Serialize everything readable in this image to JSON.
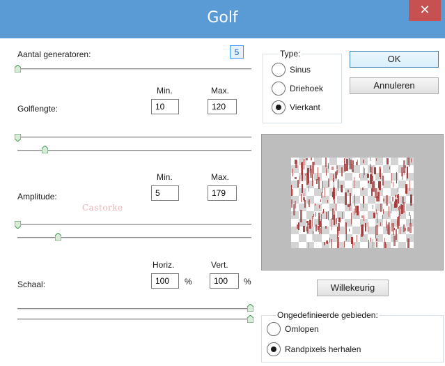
{
  "window": {
    "title": "Golf",
    "close_glyph": "✕"
  },
  "generators": {
    "label": "Aantal generatoren:",
    "value": "5",
    "slider_fraction": 0.0
  },
  "wavelength": {
    "label": "Golflengte:",
    "min_label": "Min.",
    "max_label": "Max.",
    "min_value": "10",
    "max_value": "120"
  },
  "amplitude": {
    "label": "Amplitude:",
    "min_label": "Min.",
    "max_label": "Max.",
    "min_value": "5",
    "max_value": "179"
  },
  "scale": {
    "label": "Schaal:",
    "horiz_label": "Horiz.",
    "vert_label": "Vert.",
    "horiz_value": "100",
    "vert_value": "100",
    "unit": "%"
  },
  "watermark": {
    "text": "Castorke"
  },
  "type_group": {
    "title": "Type:",
    "options": [
      {
        "label": "Sinus",
        "checked": false
      },
      {
        "label": "Driehoek",
        "checked": false
      },
      {
        "label": "Vierkant",
        "checked": true
      }
    ]
  },
  "buttons": {
    "ok": "OK",
    "cancel": "Annuleren",
    "random": "Willekeurig"
  },
  "undefined_group": {
    "title": "Ongedefinieerde gebieden:",
    "options": [
      {
        "label": "Omlopen",
        "checked": false
      },
      {
        "label": "Randpixels herhalen",
        "checked": true
      }
    ]
  },
  "colors": {
    "titlebar": "#5b9bd5",
    "close": "#c75050",
    "preview_bg": "#bdbdbd",
    "wave_red": "#a63a3a"
  },
  "icons": {
    "close": "close-icon",
    "thumb": "slider-thumb-icon"
  }
}
